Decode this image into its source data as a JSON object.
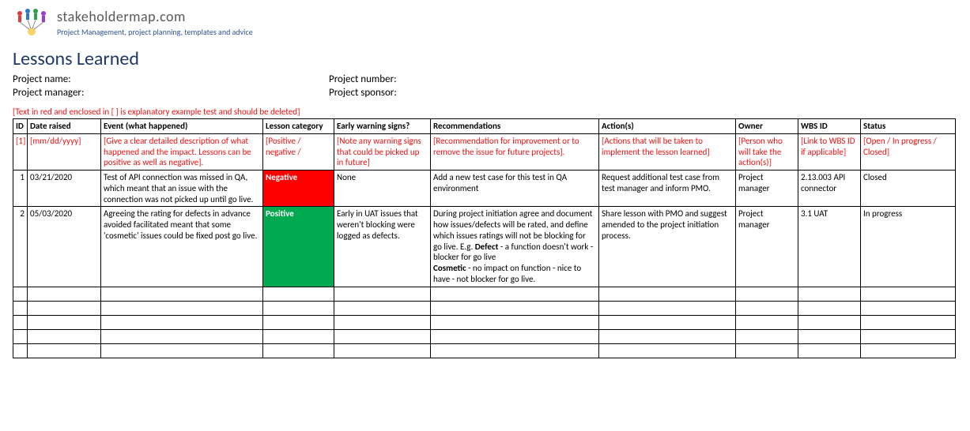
{
  "brand": {
    "name": "stakeholdermap.com",
    "tagline": "Project Management, project planning, templates and advice"
  },
  "title": "Lessons Learned",
  "meta": {
    "project_name_label": "Project name:",
    "project_number_label": "Project number:",
    "project_manager_label": "Project manager:",
    "project_sponsor_label": "Project sponsor:"
  },
  "explain_note": "[Text in red and enclosed in [ ] is explanatory example test and should be deleted]",
  "columns": {
    "id": "ID",
    "date": "Date raised",
    "event": "Event (what happened)",
    "category": "Lesson category",
    "warning": "Early warning signs?",
    "recommendations": "Recommendations",
    "actions": "Action(s)",
    "owner": "Owner",
    "wbs": "WBS ID",
    "status": "Status"
  },
  "guide_row": {
    "id": "[1]",
    "date": "[mm/dd/yyyy]",
    "event": "[Give a clear detailed description of what happened and the impact. Lessons can be positive as well as negative].",
    "category": "[Positive / negative /",
    "warning": "[Note any warning signs that could be picked up in future]",
    "recommendations": "[Recommendation for improvement or to remove the issue for future projects].",
    "actions": "[Actions that will be taken to implement the lesson learned]",
    "owner": "[Person who will take the action(s)]",
    "wbs": "[Link to WBS ID if applicable]",
    "status": "[Open / In progress / Closed]"
  },
  "rows": [
    {
      "id": "1",
      "date": "03/21/2020",
      "event": "Test of API connection was missed in QA, which meant that an issue with the connection was not picked up until go live.",
      "category": "Negative",
      "category_kind": "neg",
      "warning": "None",
      "recommendations_plain": "Add a new test case for this test in QA environment",
      "actions": "Request additional test case from test manager and inform PMO.",
      "owner": "Project manager",
      "wbs": "2.13.003 API connector",
      "status": "Closed"
    },
    {
      "id": "2",
      "date": "05/03/2020",
      "event": "Agreeing the rating for defects in advance avoided facilitated meant that some 'cosmetic' issues could be fixed post go live.",
      "category": "Positive",
      "category_kind": "pos",
      "warning": "Early in UAT issues that weren't blocking were logged as defects.",
      "recommendations_rich": {
        "prefix": "During project initiation agree and document how issues/defects will be rated, and define which issues ratings will not be blocking for go live. E.g. ",
        "b1": "Defect",
        "mid1": " - a function doesn't work - blocker for go live",
        "break": true,
        "b2": "Cosmetic",
        "mid2": " - no impact on function - nice to have - not blocker for go live."
      },
      "actions": "Share lesson with PMO and suggest amended to the project initiation process.",
      "owner": "Project manager",
      "wbs": "3.1 UAT",
      "status": "In progress"
    }
  ],
  "empty_row_count": 5,
  "chart_data": {
    "type": "table",
    "columns": [
      "ID",
      "Date raised",
      "Event (what happened)",
      "Lesson category",
      "Early warning signs?",
      "Recommendations",
      "Action(s)",
      "Owner",
      "WBS ID",
      "Status"
    ],
    "rows": [
      [
        "1",
        "03/21/2020",
        "Test of API connection was missed in QA, which meant that an issue with the connection was not picked up until go live.",
        "Negative",
        "None",
        "Add a new test case for this test in QA environment",
        "Request additional test case from test manager and inform PMO.",
        "Project manager",
        "2.13.003 API connector",
        "Closed"
      ],
      [
        "2",
        "05/03/2020",
        "Agreeing the rating for defects in advance avoided facilitated meant that some 'cosmetic' issues could be fixed post go live.",
        "Positive",
        "Early in UAT issues that weren't blocking were logged as defects.",
        "During project initiation agree and document how issues/defects will be rated, and define which issues ratings will not be blocking for go live. E.g. Defect - a function doesn't work - blocker for go live. Cosmetic - no impact on function - nice to have - not blocker for go live.",
        "Share lesson with PMO and suggest amended to the project initiation process.",
        "Project manager",
        "3.1 UAT",
        "In progress"
      ]
    ]
  }
}
